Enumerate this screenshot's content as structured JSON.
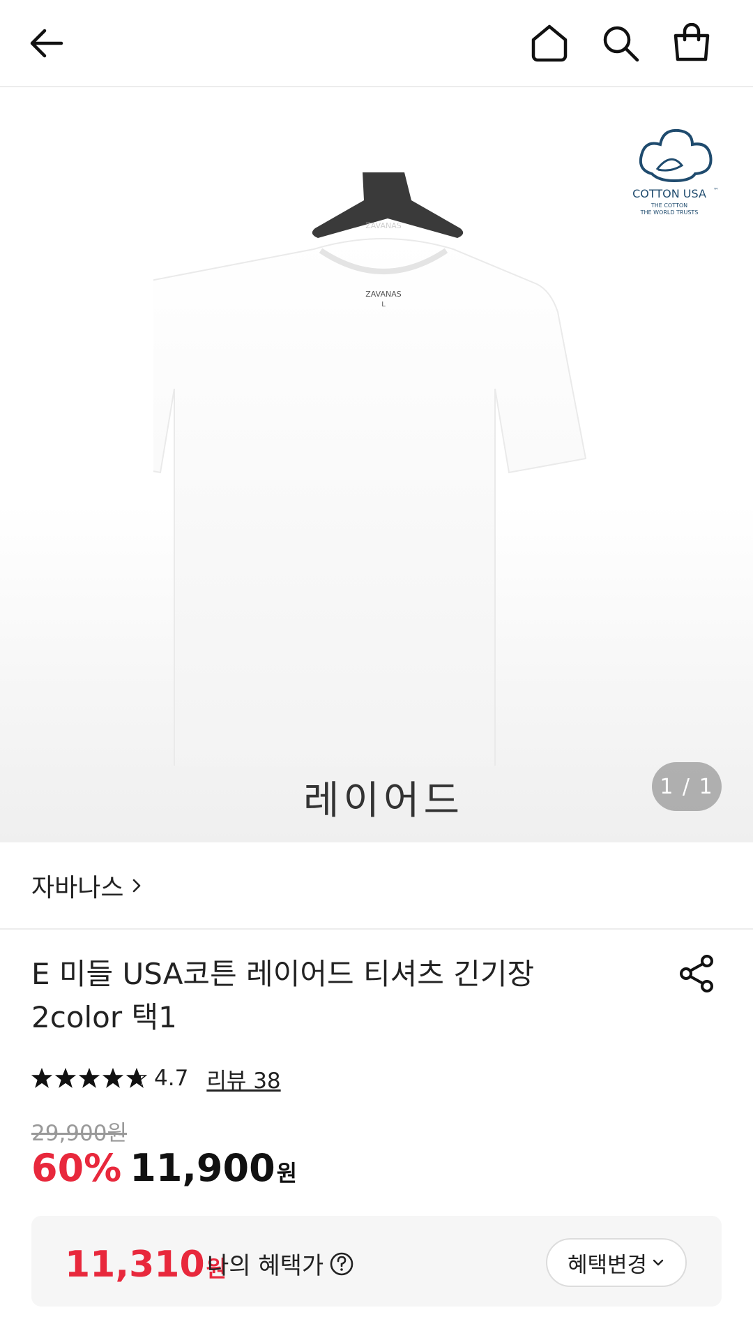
{
  "header": {
    "icons": [
      "back-arrow-icon",
      "home-icon",
      "search-icon",
      "shopping-bag-icon"
    ]
  },
  "hero": {
    "hanger_text": "ZAVANAS",
    "neck_label_brand": "ZAVANAS",
    "neck_label_size": "L",
    "cotton_logo_title": "COTTON USA",
    "cotton_logo_tm": "™",
    "cotton_logo_line1": "THE COTTON",
    "cotton_logo_line2": "THE WORLD TRUSTS",
    "caption": "레이어드",
    "page_indicator": "1 / 1"
  },
  "brand": {
    "name": "자바나스"
  },
  "product": {
    "title_line1": "E 미들 USA코튼 레이어드 티셔츠 긴기장",
    "title_line2": "2color 택1",
    "rating": "4.7",
    "rating_stars": 4.7,
    "review_link": "리뷰 38",
    "original_price": "29,900원",
    "discount": "60%",
    "price": "11,900",
    "price_unit": "원"
  },
  "benefit": {
    "price": "11,310",
    "price_unit": "원",
    "label": "나의 혜택가",
    "change_button": "혜택변경",
    "accent_color": "#e8283c"
  }
}
